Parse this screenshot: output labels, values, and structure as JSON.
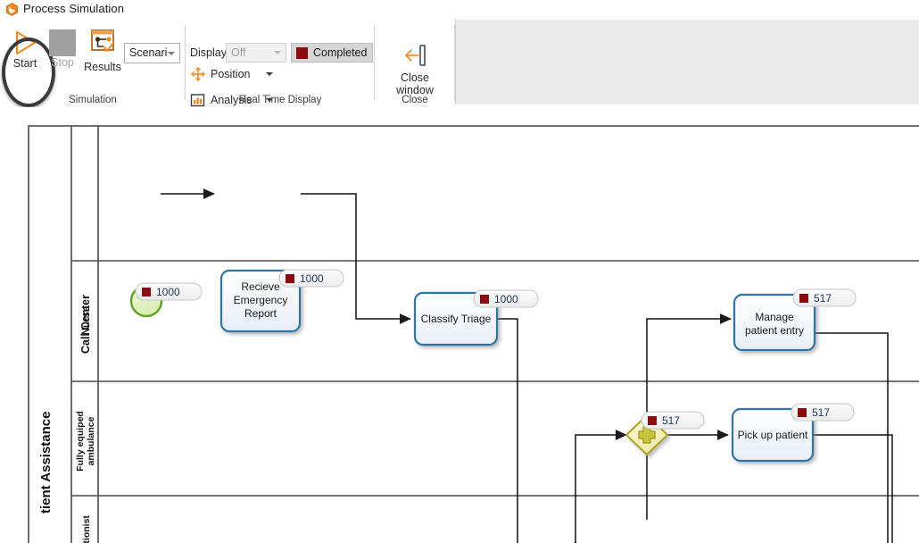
{
  "window": {
    "title": "Process Simulation",
    "app_icon": "hexagon-icon"
  },
  "ribbon": {
    "groups": [
      {
        "id": "simulation",
        "label": "Simulation"
      },
      {
        "id": "real_time_display",
        "label": "Real Time Display"
      },
      {
        "id": "close",
        "label": "Close"
      }
    ],
    "simulation": {
      "start": {
        "label": "Start",
        "icon": "play-icon",
        "highlighted": true
      },
      "stop": {
        "label": "Stop",
        "icon": "stop-icon",
        "disabled": true
      },
      "results": {
        "label": "Results",
        "icon": "results-icon"
      },
      "scenario_combo": {
        "value": "Scenari",
        "placeholder": "Scenari"
      }
    },
    "real_time_display": {
      "display_label": "Display",
      "display_combo": {
        "value": "Off",
        "placeholder": "Off",
        "disabled": true
      },
      "completed_button": {
        "label": "Completed",
        "swatch": "#8C0B10",
        "active": true
      },
      "position": {
        "label": "Position",
        "icon": "move-icon"
      },
      "analysis": {
        "label": "Analysis",
        "icon": "bar-chart-icon"
      }
    },
    "close": {
      "close_window": {
        "label_line1": "Close",
        "label_line2": "window",
        "icon": "back-arrow-icon"
      }
    }
  },
  "diagram": {
    "pool_label": "tient Assistance",
    "lanes": [
      {
        "id": "call-center",
        "label": "Call Center"
      },
      {
        "id": "nurse",
        "label": "Nurse"
      },
      {
        "id": "ambulance",
        "label": "Fully equiped ambulance"
      },
      {
        "id": "receptionist",
        "label": "ptionist"
      }
    ],
    "nodes": [
      {
        "id": "start-event",
        "type": "start-event",
        "label": "",
        "badge": "1000"
      },
      {
        "id": "recieve-emergency-report",
        "type": "task",
        "label": "Recieve Emergency Report",
        "badge": "1000"
      },
      {
        "id": "classify-triage",
        "type": "task",
        "label": "Classify Triage",
        "badge": "1000"
      },
      {
        "id": "manage-patient-entry",
        "type": "task",
        "label": "Manage patient entry",
        "badge": "517"
      },
      {
        "id": "parallel-gateway",
        "type": "parallel-gateway",
        "label": "",
        "badge": "517"
      },
      {
        "id": "pick-up-patient",
        "type": "task",
        "label": "Pick up patient",
        "badge": "517"
      }
    ],
    "badge_marker_color": "#8C0B10",
    "badge_text_color": "#1F3864",
    "task_border_color": "#2E75A8",
    "start_event_color": "#5EA227",
    "gateway_color": "#ADA520"
  }
}
